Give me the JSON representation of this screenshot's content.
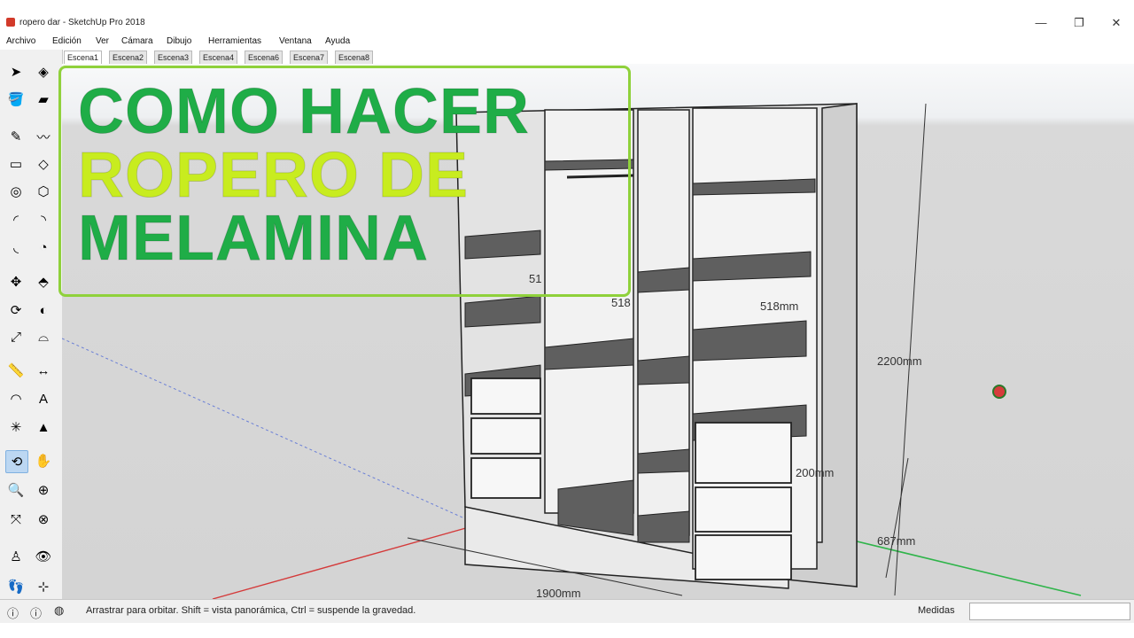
{
  "window": {
    "title": "ropero dar - SketchUp Pro 2018",
    "buttons": {
      "minimize": "—",
      "maximize": "❐",
      "close": "✕"
    }
  },
  "menu": [
    "Archivo",
    "Edición",
    "Ver",
    "Cámara",
    "Dibujo",
    "Herramientas",
    "Ventana",
    "Ayuda"
  ],
  "scenes": {
    "tabs": [
      "Escena1",
      "Escena2",
      "Escena3",
      "Escena4",
      "Escena6",
      "Escena7",
      "Escena8"
    ],
    "active": "Escena1"
  },
  "overlay": {
    "line1": "COMO HACER",
    "line2": "ROPERO DE",
    "line3": "MELAMINA",
    "colors": {
      "green": "#1fad47",
      "lime": "#c8ec1f",
      "border": "#8fd13b"
    }
  },
  "dimensions": {
    "height": "2200mm",
    "width": "1900mm",
    "depth_a": "518mm",
    "depth_b": "518",
    "depth_c": "51",
    "drawer_a": "200mm",
    "drawer_b": "687mm"
  },
  "status": {
    "text": "Arrastrar para orbitar. Shift = vista panorámica, Ctrl = suspende la gravedad.",
    "measure_label": "Medidas",
    "measure_value": ""
  },
  "tools": [
    {
      "name": "select-tool-icon",
      "glyph": "➤"
    },
    {
      "name": "component-tool-icon",
      "glyph": "◈"
    },
    {
      "name": "paint-bucket-tool-icon",
      "glyph": "🪣"
    },
    {
      "name": "eraser-tool-icon",
      "glyph": "▰"
    },
    {
      "name": "line-tool-icon",
      "glyph": "✎"
    },
    {
      "name": "freehand-tool-icon",
      "glyph": "〰"
    },
    {
      "name": "rectangle-tool-icon",
      "glyph": "▭"
    },
    {
      "name": "rotated-rectangle-tool-icon",
      "glyph": "◇"
    },
    {
      "name": "circle-tool-icon",
      "glyph": "◎"
    },
    {
      "name": "polygon-tool-icon",
      "glyph": "⬡"
    },
    {
      "name": "arc-tool-icon",
      "glyph": "◜"
    },
    {
      "name": "two-point-arc-tool-icon",
      "glyph": "◝"
    },
    {
      "name": "three-point-arc-tool-icon",
      "glyph": "◟"
    },
    {
      "name": "pie-tool-icon",
      "glyph": "◔"
    },
    {
      "name": "move-tool-icon",
      "glyph": "✥"
    },
    {
      "name": "push-pull-tool-icon",
      "glyph": "⬘"
    },
    {
      "name": "rotate-tool-icon",
      "glyph": "⟳"
    },
    {
      "name": "follow-me-tool-icon",
      "glyph": "◐"
    },
    {
      "name": "scale-tool-icon",
      "glyph": "⤢"
    },
    {
      "name": "offset-tool-icon",
      "glyph": "⌓"
    },
    {
      "name": "tape-measure-tool-icon",
      "glyph": "📏"
    },
    {
      "name": "dimension-tool-icon",
      "glyph": "↔"
    },
    {
      "name": "protractor-tool-icon",
      "glyph": "◠"
    },
    {
      "name": "text-tool-icon",
      "glyph": "A"
    },
    {
      "name": "axes-tool-icon",
      "glyph": "✳"
    },
    {
      "name": "3d-text-tool-icon",
      "glyph": "▲"
    },
    {
      "name": "orbit-tool-icon",
      "glyph": "⟲"
    },
    {
      "name": "pan-tool-icon",
      "glyph": "✋"
    },
    {
      "name": "zoom-tool-icon",
      "glyph": "🔍"
    },
    {
      "name": "zoom-window-tool-icon",
      "glyph": "⊕"
    },
    {
      "name": "zoom-extents-tool-icon",
      "glyph": "⤧"
    },
    {
      "name": "previous-view-tool-icon",
      "glyph": "⊗"
    },
    {
      "name": "position-camera-tool-icon",
      "glyph": "♙"
    },
    {
      "name": "look-around-tool-icon",
      "glyph": "👁"
    },
    {
      "name": "walk-tool-icon",
      "glyph": "👣"
    },
    {
      "name": "section-plane-tool-icon",
      "glyph": "⊹"
    }
  ]
}
